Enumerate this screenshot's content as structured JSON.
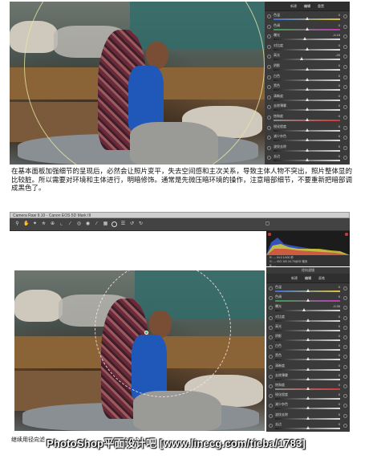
{
  "top_panel": {
    "tabs": [
      "新建",
      "编辑",
      "重置"
    ],
    "sliders": [
      {
        "label": "色温",
        "value": "0",
        "gradient": "temp",
        "pos": 0.5
      },
      {
        "label": "色调",
        "value": "0",
        "gradient": "tint",
        "pos": 0.5
      },
      {
        "label": "曝光",
        "value": "-0.15",
        "gradient": "gray",
        "pos": 0.47
      },
      {
        "label": "对比度",
        "value": "0",
        "gradient": "gray",
        "pos": 0.5
      },
      {
        "label": "高光",
        "value": "-20",
        "gradient": "gray",
        "pos": 0.42
      },
      {
        "label": "阴影",
        "value": "0",
        "gradient": "gray",
        "pos": 0.5
      },
      {
        "label": "白色",
        "value": "0",
        "gradient": "gray",
        "pos": 0.5
      },
      {
        "label": "黑色",
        "value": "0",
        "gradient": "gray",
        "pos": 0.5
      },
      {
        "label": "清晰度",
        "value": "0",
        "gradient": "gray",
        "pos": 0.5
      },
      {
        "label": "去除薄雾",
        "value": "0",
        "gradient": "gray",
        "pos": 0.5
      },
      {
        "label": "饱和度",
        "value": "0",
        "gradient": "sat",
        "pos": 0.5
      },
      {
        "label": "锐化程度",
        "value": "0",
        "gradient": "gray",
        "pos": 0.5
      },
      {
        "label": "减少杂色",
        "value": "0",
        "gradient": "gray",
        "pos": 0.5
      },
      {
        "label": "波纹去除",
        "value": "0",
        "gradient": "gray",
        "pos": 0.5
      },
      {
        "label": "去边",
        "value": "0",
        "gradient": "gray",
        "pos": 0.5
      }
    ]
  },
  "caption_1": "在基本面板加强细节的呈现后，必然会让照片变平，失去空间感和主次关系，导致主体人物不突出，照片整体显的比较脏。所以需要对环境和主体进行，明暗修饰。通常是先微压暗环境的操作，注意暗部细节，不要重新把暗部调成黑色了。",
  "window": {
    "title": "Camera Raw 9.10 - Canon EOS 5D Mark III",
    "tools": [
      "zoom-tool",
      "hand-tool",
      "white-balance-tool",
      "color-sampler-tool",
      "targeted-adjustment-tool",
      "crop-tool",
      "straighten-tool",
      "spot-removal-tool",
      "red-eye-tool",
      "adjustment-brush",
      "graduated-filter",
      "radial-filter",
      "preferences",
      "rotate-left",
      "rotate-right"
    ],
    "info_lines": [
      "R:  ---   f/4.0   1/400 秒",
      "G:  ---   ISO 100   24-70@33 毫米",
      "B:  ---"
    ],
    "panel_title": "径向滤镜",
    "tabs": [
      "新建",
      "编辑",
      "画笔"
    ],
    "sliders": [
      {
        "label": "色温",
        "value": "0",
        "gradient": "temp",
        "pos": 0.5
      },
      {
        "label": "色调",
        "value": "0",
        "gradient": "tint",
        "pos": 0.5
      },
      {
        "label": "曝光",
        "value": "-0.35",
        "gradient": "gray",
        "pos": 0.44
      },
      {
        "label": "对比度",
        "value": "0",
        "gradient": "gray",
        "pos": 0.5
      },
      {
        "label": "高光",
        "value": "0",
        "gradient": "gray",
        "pos": 0.5
      },
      {
        "label": "阴影",
        "value": "0",
        "gradient": "gray",
        "pos": 0.5
      },
      {
        "label": "白色",
        "value": "0",
        "gradient": "gray",
        "pos": 0.5
      },
      {
        "label": "黑色",
        "value": "0",
        "gradient": "gray",
        "pos": 0.5
      },
      {
        "label": "清晰度",
        "value": "0",
        "gradient": "gray",
        "pos": 0.5
      },
      {
        "label": "去除薄雾",
        "value": "0",
        "gradient": "gray",
        "pos": 0.5
      },
      {
        "label": "饱和度",
        "value": "0",
        "gradient": "sat",
        "pos": 0.5
      },
      {
        "label": "锐化程度",
        "value": "0",
        "gradient": "gray",
        "pos": 0.5
      },
      {
        "label": "减少杂色",
        "value": "0",
        "gradient": "gray",
        "pos": 0.5
      },
      {
        "label": "波纹去除",
        "value": "0",
        "gradient": "gray",
        "pos": 0.5
      },
      {
        "label": "去边",
        "value": "0",
        "gradient": "gray",
        "pos": 0.5
      }
    ]
  },
  "caption_2": "继续用径向滤",
  "caption_2_tail": "的",
  "watermark": "PhotoShop平面设计吧 [www.linecg.com/tieba/1783]",
  "colors": {
    "panel_bg": "#3a3a3a",
    "toolbar_bg": "#434343",
    "shirt_blue": "#1f58b8"
  }
}
